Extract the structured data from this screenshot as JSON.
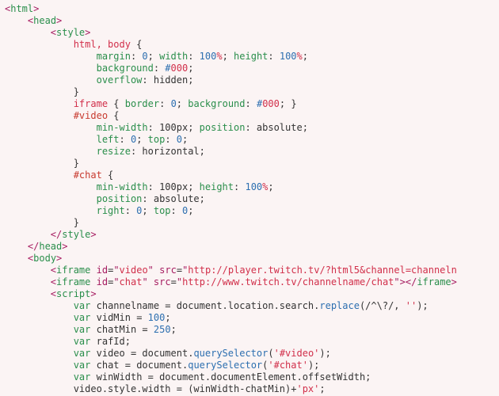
{
  "code": {
    "lang": "html",
    "tags": {
      "html_open": "html",
      "html_close": "html",
      "head_open": "head",
      "head_close": "head",
      "style_open": "style",
      "style_close": "style",
      "body_open": "body",
      "iframe": "iframe",
      "script_open": "script"
    },
    "css": {
      "sel_html_body": "html, body",
      "p_margin": "margin",
      "v_margin": "0",
      "p_width": "width",
      "v_100pct": "100",
      "u_pct": "%",
      "p_height": "height",
      "p_background": "background",
      "v_hash": "#",
      "v_000": "000",
      "p_overflow": "overflow",
      "v_hidden": "hidden",
      "sel_iframe": "iframe",
      "p_border": "border",
      "sel_video": "#video",
      "p_minwidth": "min-width",
      "v_100px": "100px",
      "p_position": "position",
      "v_absolute": "absolute",
      "p_left": "left",
      "p_top": "top",
      "p_resize": "resize",
      "v_horizontal": "horizontal",
      "sel_chat": "#chat",
      "p_right": "right"
    },
    "attrs": {
      "id": "id",
      "src": "src",
      "video_id": "video",
      "video_src": "http://player.twitch.tv/?html5&channel=channeln",
      "chat_id": "chat",
      "chat_src": "http://www.twitch.tv/channelname/chat",
      "iframe_close": "iframe"
    },
    "js": {
      "var": "var",
      "l1_a": " channelname = document.location.search.",
      "l1_b": "replace",
      "l1_c": "(/^\\?/, ",
      "l1_d": "''",
      "l1_e": ");",
      "l2_a": " vidMin = ",
      "l2_b": "100",
      "l2_c": ";",
      "l3_a": " chatMin = ",
      "l3_b": "250",
      "l3_c": ";",
      "l4": " rafId;",
      "l5_a": " video = document.",
      "l5_b": "querySelector",
      "l5_c": "(",
      "l5_d": "'#video'",
      "l5_e": ");",
      "l6_a": " chat = document.",
      "l6_b": "querySelector",
      "l6_c": "(",
      "l6_d": "'#chat'",
      "l6_e": ");",
      "l7": " winWidth = document.documentElement.offsetWidth;",
      "l8_a": "video.style.width = (winWidth-chatMin)+",
      "l8_b": "'px'",
      "l8_c": ";"
    }
  }
}
